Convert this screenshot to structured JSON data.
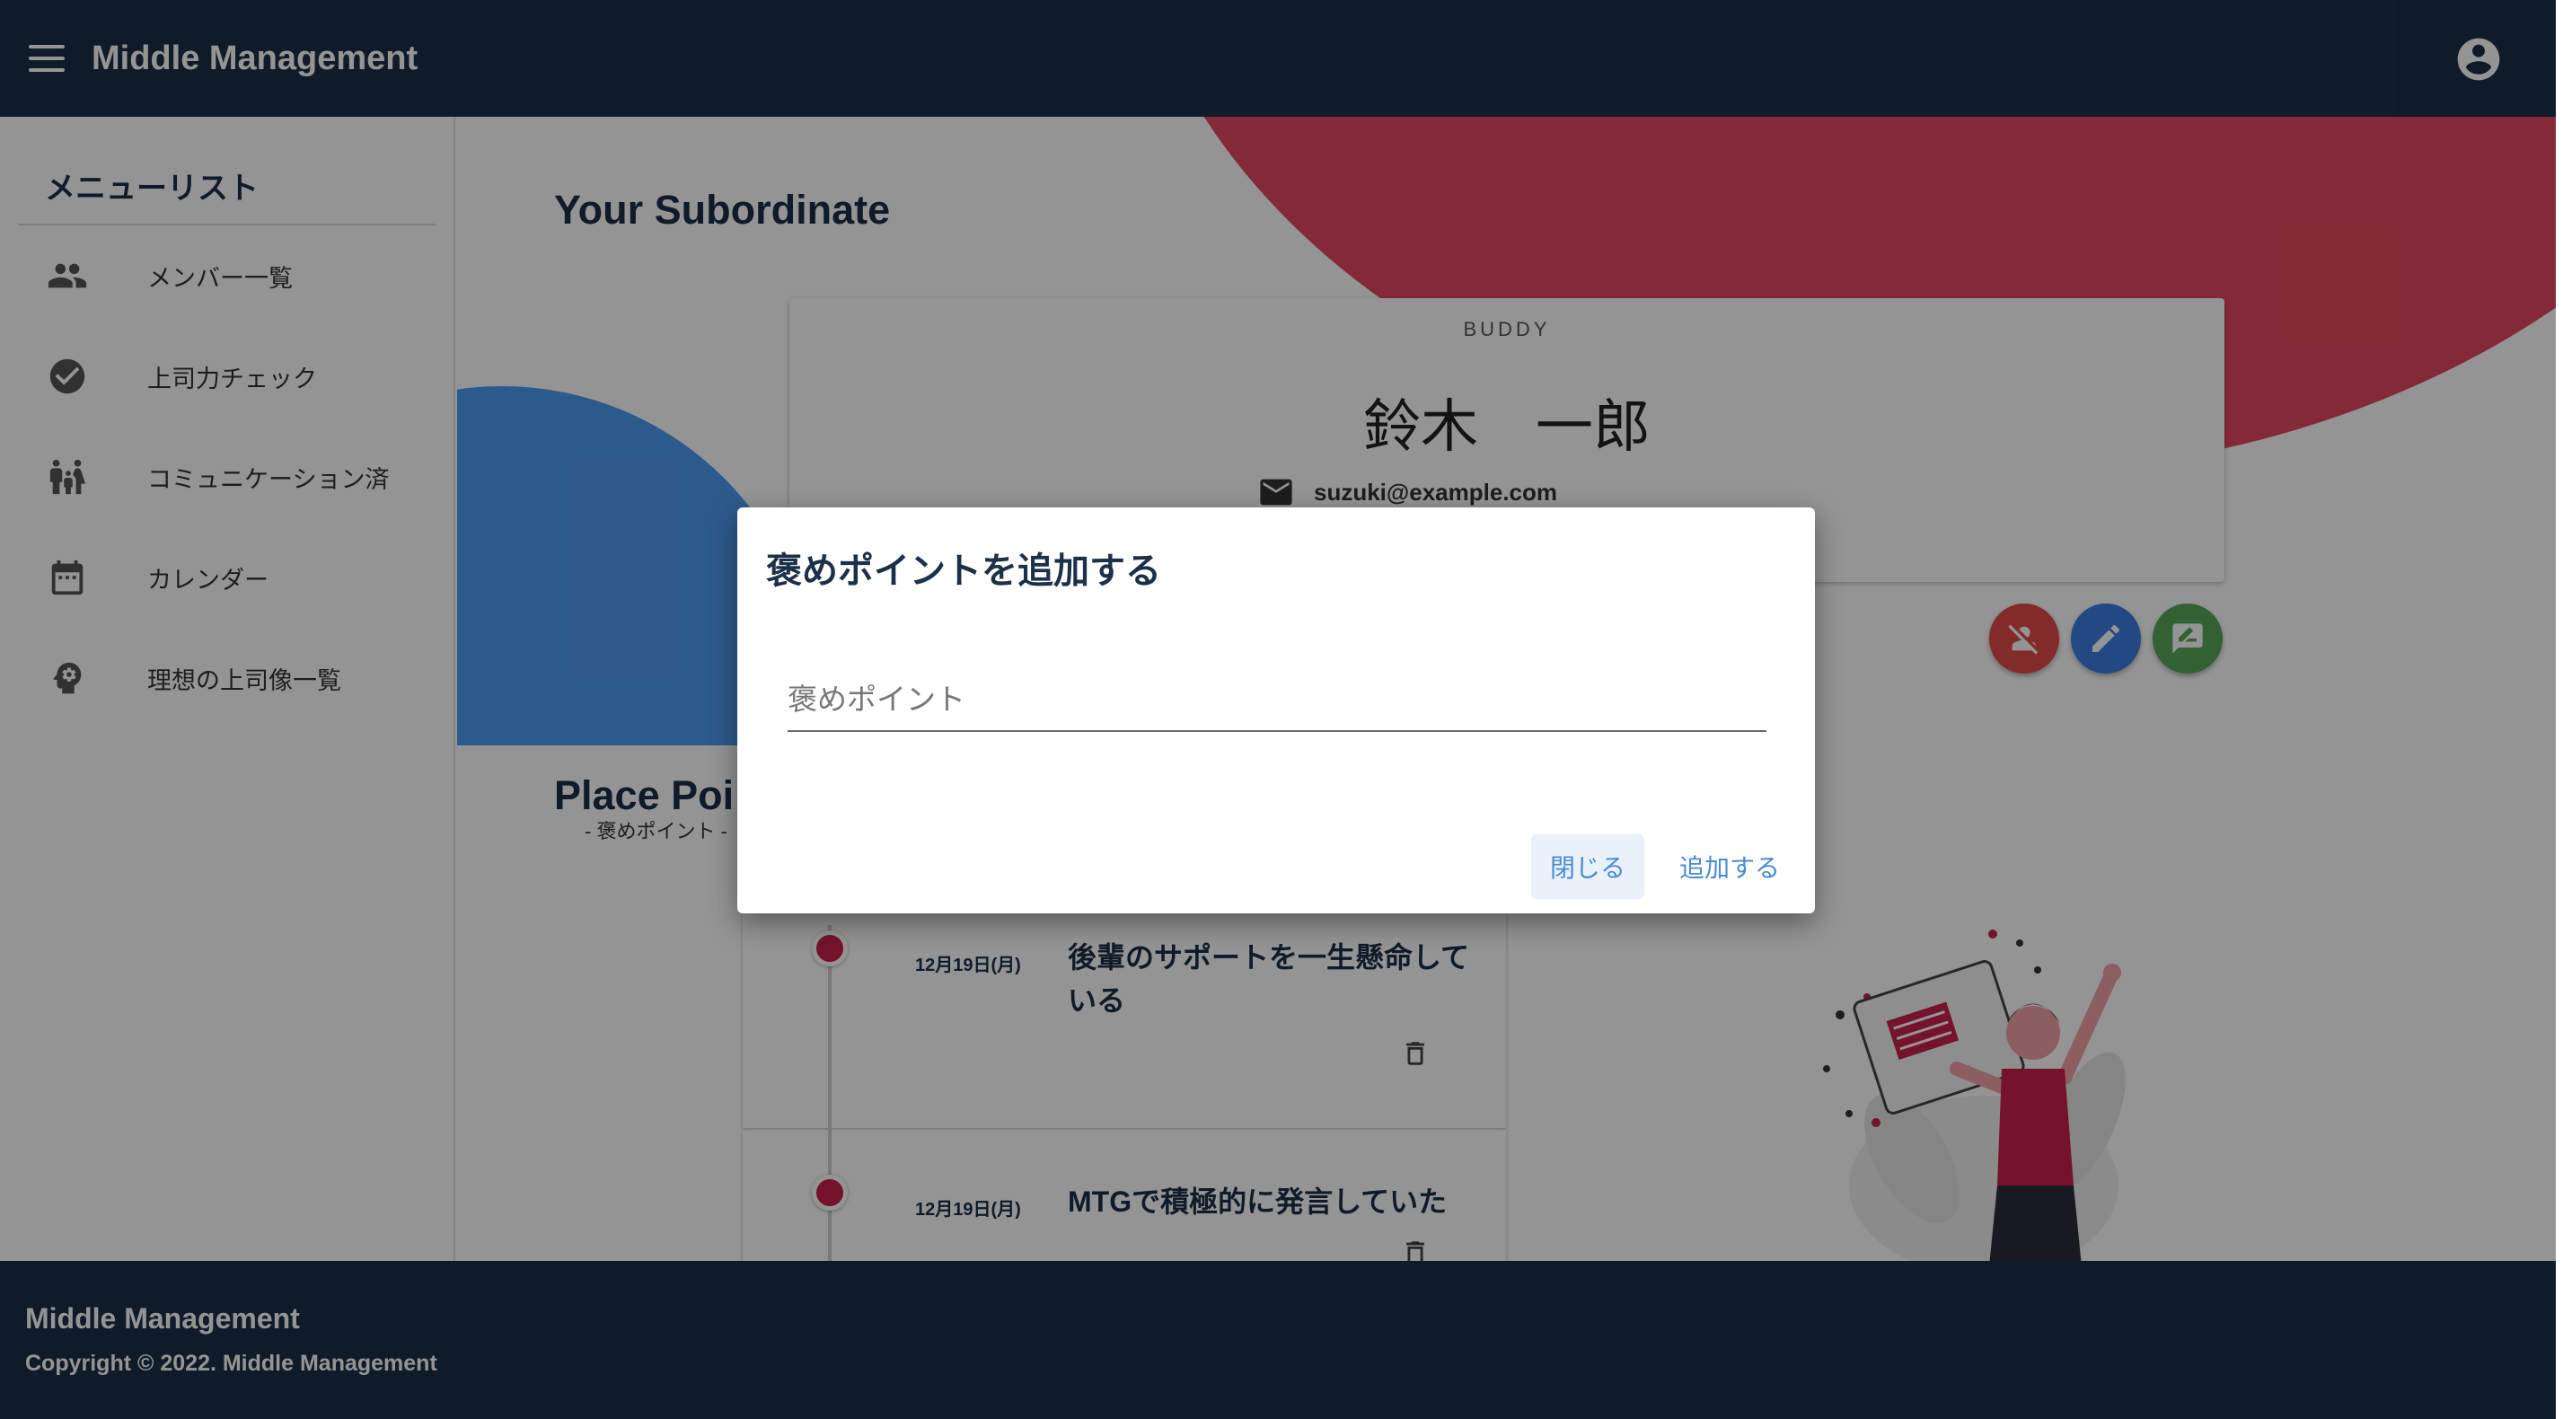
{
  "app": {
    "title": "Middle Management"
  },
  "sidebar": {
    "title": "メニューリスト",
    "items": [
      {
        "label": "メンバー一覧",
        "icon": "people-icon"
      },
      {
        "label": "上司力チェック",
        "icon": "check-circle-icon"
      },
      {
        "label": "コミュニケーション済",
        "icon": "people-heart-icon"
      },
      {
        "label": "カレンダー",
        "icon": "calendar-icon"
      },
      {
        "label": "理想の上司像一覧",
        "icon": "psychology-icon"
      }
    ]
  },
  "main": {
    "subordinate_title": "Your Subordinate",
    "buddy": {
      "label": "BUDDY",
      "name": "鈴木　一郎",
      "email": "suzuki@example.com"
    },
    "points_title": "Place Poi",
    "points_subtitle": "- 褒めポイント -",
    "timeline": [
      {
        "date": "12月19日(月)",
        "text": "後輩のサポートを一生懸命している"
      },
      {
        "date": "12月19日(月)",
        "text": "MTGで積極的に発言していた"
      }
    ]
  },
  "dialog": {
    "title": "褒めポイントを追加する",
    "field_placeholder": "褒めポイント",
    "field_value": "",
    "close_label": "閉じる",
    "add_label": "追加する"
  },
  "footer": {
    "title": "Middle Management",
    "copyright": "Copyright © 2022. Middle Management"
  },
  "colors": {
    "primary": "#1c3048",
    "accent_red": "#e2485f",
    "accent_blue": "#4f9bf2",
    "fab_red": "#e24a4a",
    "fab_blue": "#3d7fe3",
    "fab_green": "#56a85a",
    "link_blue": "#4a8bd6"
  }
}
